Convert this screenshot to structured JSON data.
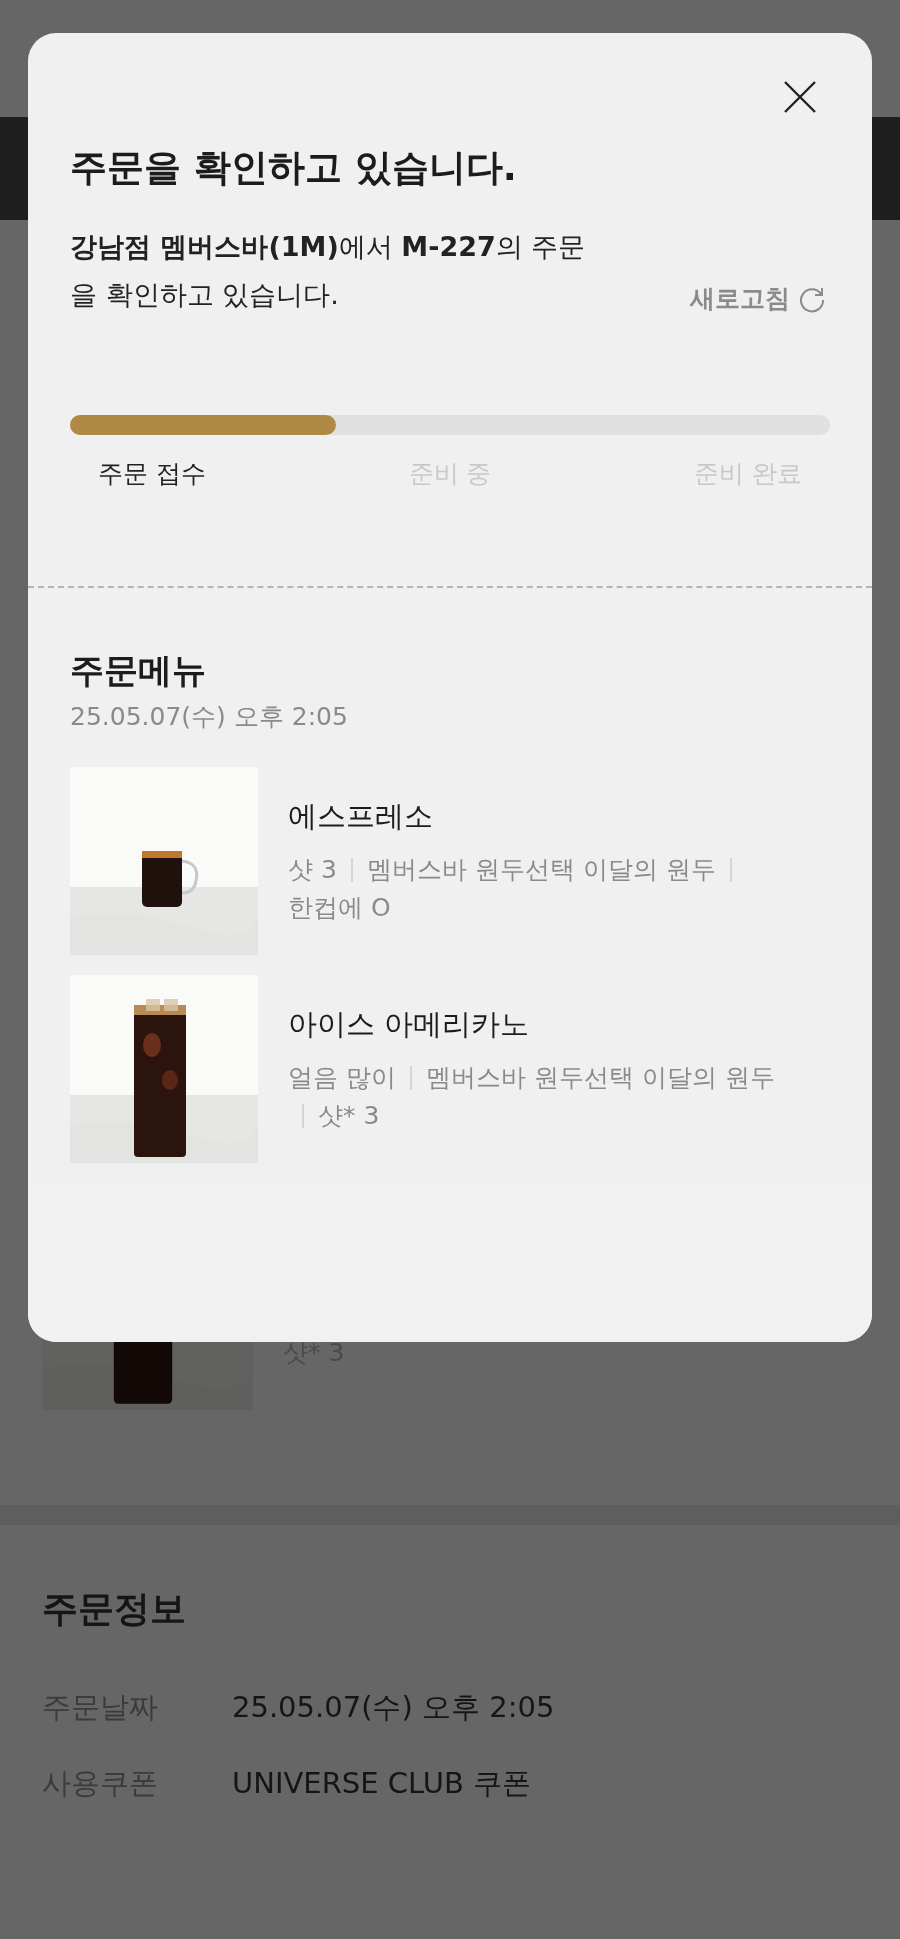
{
  "background": {
    "item": {
      "option": "샷* 3"
    },
    "order_info": {
      "title": "주문정보",
      "rows": [
        {
          "label": "주문날짜",
          "value": "25.05.07(수) 오후 2:05"
        },
        {
          "label": "사용쿠폰",
          "value": "UNIVERSE CLUB 쿠폰"
        }
      ]
    }
  },
  "modal": {
    "title": "주문을 확인하고 있습니다.",
    "message_lines": [
      "**강남점 멤버스바(1M)**에서 **M-227**의 주문",
      "을 확인하고 있습니다."
    ],
    "refresh": "새로고침",
    "progress": {
      "level": 0.35
    },
    "steps": [
      {
        "label": "주문 접수",
        "active": true
      },
      {
        "label": "준비 중",
        "active": false
      },
      {
        "label": "준비 완료",
        "active": false
      }
    ],
    "menu": {
      "title": "주문메뉴",
      "date": "25.05.07(수) 오후 2:05",
      "items": [
        {
          "kind": "hot",
          "name": "에스프레소",
          "options": [
            "샷 3",
            "멤버스바 원두선택 이달의 원두",
            "한컵에 O"
          ]
        },
        {
          "kind": "iced",
          "name": "아이스 아메리카노",
          "options": [
            "얼음 많이",
            "멤버스바 원두선택 이달의 원두",
            "샷* 3"
          ]
        }
      ]
    }
  }
}
